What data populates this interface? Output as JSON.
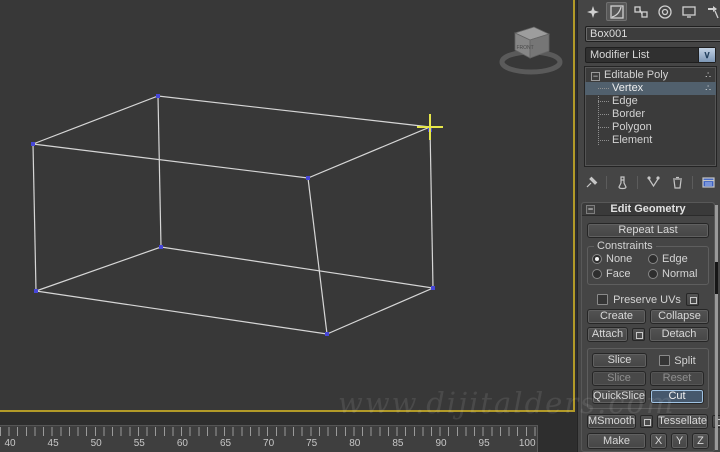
{
  "viewport": {
    "viewcube_front_label": "FRONT",
    "watermark_text": "www.dijitalders.com",
    "colors": {
      "background": "#383838",
      "wireframe": "#d6d6d6",
      "vertex": "#4646d8",
      "cursor_cross": "#e6e64a",
      "active_viewport_border": "#b29a28"
    }
  },
  "command_panel": {
    "tabs": [
      {
        "name": "create"
      },
      {
        "name": "modify",
        "active": true
      },
      {
        "name": "hierarchy"
      },
      {
        "name": "motion"
      },
      {
        "name": "display"
      },
      {
        "name": "utilities"
      }
    ],
    "object_name": "Box001",
    "object_color": "#7cc63f",
    "modifier_list_label": "Modifier List",
    "stack": {
      "rows": [
        {
          "label": "Editable Poly",
          "indent": 0,
          "expandable": true,
          "indicator": true
        },
        {
          "label": "Vertex",
          "indent": 1,
          "selected": true,
          "indicator": true
        },
        {
          "label": "Edge",
          "indent": 1
        },
        {
          "label": "Border",
          "indent": 1
        },
        {
          "label": "Polygon",
          "indent": 1
        },
        {
          "label": "Element",
          "indent": 1
        }
      ]
    },
    "stack_toolbar_icons": [
      "pin-stack",
      "show-end-result",
      "make-unique",
      "remove-modifier",
      "configure-modifier-sets"
    ],
    "edit_geometry": {
      "title": "Edit Geometry",
      "repeat_last": "Repeat Last",
      "constraints": {
        "title": "Constraints",
        "options": [
          "None",
          "Edge",
          "Face",
          "Normal"
        ],
        "selected": "None"
      },
      "preserve_uvs": "Preserve UVs",
      "create": "Create",
      "collapse": "Collapse",
      "attach": "Attach",
      "detach": "Detach",
      "slice_plane": "Slice Plane",
      "split": "Split",
      "slice": "Slice",
      "reset_plane": "Reset Plane",
      "quickslice": "QuickSlice",
      "cut": "Cut",
      "active_button": "Cut",
      "disabled_buttons": [
        "Slice",
        "Reset Plane"
      ],
      "msmooth": "MSmooth",
      "tessellate": "Tessellate",
      "make_planar": "Make Planar",
      "axis": [
        "X",
        "Y",
        "Z"
      ]
    }
  },
  "timeline": {
    "tick_labels": [
      40,
      45,
      50,
      55,
      60,
      65,
      70,
      75,
      80,
      85,
      90,
      95,
      100
    ]
  },
  "glyphs": {
    "collapse_minus": "−",
    "dropdown_chevron": "∨",
    "subobject_indicator": "∴"
  }
}
